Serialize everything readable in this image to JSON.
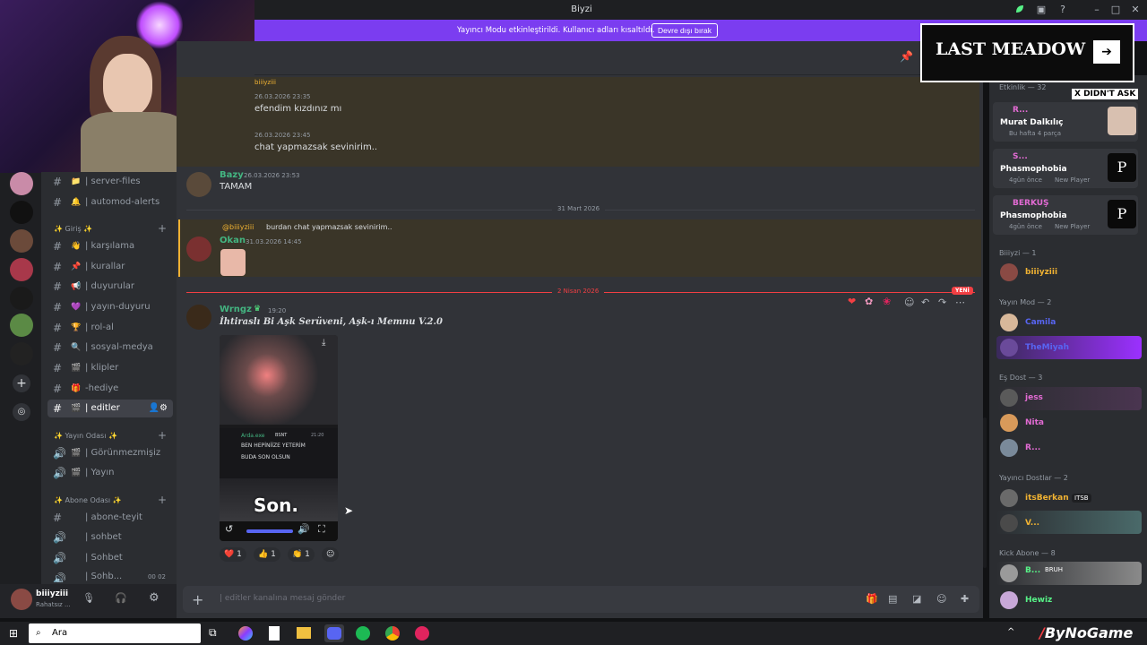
{
  "window": {
    "title": "Biyzi"
  },
  "banner": {
    "text": "Yayıncı Modu etkinleştirildi. Kullanıcı adları kısaltıldı.",
    "button": "Devre dışı bırak"
  },
  "overlay": {
    "ad_title": "LAST MEADOW",
    "ad_tag": "X DIDN'T ASK",
    "watermark": "ByNoGame"
  },
  "channels": {
    "top": [
      {
        "emoji": "📁",
        "name": "| server-files"
      },
      {
        "emoji": "🔔",
        "name": "| automod-alerts"
      }
    ],
    "cat1": {
      "name": "✨ Giriş ✨"
    },
    "cat1_items": [
      {
        "emoji": "👋",
        "name": "| karşılama"
      },
      {
        "emoji": "📌",
        "name": "| kurallar"
      },
      {
        "emoji": "📢",
        "name": "| duyurular"
      },
      {
        "emoji": "💜",
        "name": "| yayın-duyuru"
      },
      {
        "emoji": "🏆",
        "name": "| rol-al"
      },
      {
        "emoji": "🔍",
        "name": "| sosyal-medya"
      },
      {
        "emoji": "🎬",
        "name": "| klipler"
      },
      {
        "emoji": "🎁",
        "name": "-hediye"
      },
      {
        "emoji": "🎬",
        "name": "| editler"
      }
    ],
    "cat2": {
      "name": "✨ Yayın Odası ✨"
    },
    "cat2_items": [
      {
        "emoji": "🎬",
        "name": "| Görünmezmişiz"
      },
      {
        "emoji": "🎬",
        "name": "| Yayın"
      }
    ],
    "cat3": {
      "name": "✨ Abone Odası ✨"
    },
    "cat3_items": [
      {
        "emoji": "",
        "name": "| abone-teyit"
      },
      {
        "emoji": "",
        "name": "| sohbet"
      },
      {
        "emoji": "",
        "name": "| Sohbet"
      },
      {
        "emoji": "",
        "name": "| Sohb..."
      }
    ],
    "voice_counts": "00  02"
  },
  "user": {
    "name": "biiiyziii",
    "status": "Rahatsız ..."
  },
  "messages": [
    {
      "name": "biiiyziii",
      "time": "",
      "text": ""
    },
    {
      "name": "",
      "time": "26.03.2026 23:35",
      "text": "efendim kızdınız mı"
    },
    {
      "name": "",
      "time": "26.03.2026 23:45",
      "text": "chat yapmazsak sevinirim.."
    },
    {
      "name": "Bazy",
      "time": "26.03.2026 23:53",
      "text": "TAMAM"
    }
  ],
  "divider1": "31 Mart 2026",
  "reply": {
    "author": "@biiiyziii",
    "text": "burdan chat yapmazsak sevinirim.."
  },
  "okan": {
    "name": "Okan",
    "time": "31.03.2026 14:45"
  },
  "divider2": "2 Nisan 2026",
  "new_badge": "YENİ",
  "wrngz": {
    "name": "Wrngz",
    "time": "19:20",
    "text": "İhtiraslı Bi Aşk Serüveni, Aşk-ı Memnu V.2.0"
  },
  "video": {
    "inner_user": "Arda.exe",
    "inner_badge": "BSNT",
    "inner_time": "21:20",
    "inner_line1": "BEN HEPİNİİZE YETERİM",
    "inner_line2": "BUDA SON OLSUN",
    "subtitle": "Son."
  },
  "reactions": [
    {
      "emoji": "❤️",
      "count": "1"
    },
    {
      "emoji": "👍",
      "count": "1"
    },
    {
      "emoji": "👏",
      "count": "1"
    }
  ],
  "input": {
    "placeholder": "| editler kanalına mesaj gönder"
  },
  "members": {
    "activity_header": "Etkinlik — 32",
    "activity": [
      {
        "name": "R...",
        "game": "Murat Dalkılıç",
        "sub": "Bu hafta 4 parça"
      },
      {
        "name": "S...",
        "game": "Phasmophobia",
        "sub": "4gün önce",
        "extra": "New Player"
      },
      {
        "name": "BERKUŞ",
        "game": "Phasmophobia",
        "sub": "4gün önce",
        "extra": "New Player"
      }
    ],
    "groups": [
      {
        "header": "Biiiyzi — 1",
        "items": [
          {
            "name": "biiiyziii",
            "color": "#f0b232"
          }
        ]
      },
      {
        "header": "Yayın Mod — 2",
        "items": [
          {
            "name": "Camila",
            "color": "#5865f2"
          },
          {
            "name": "TheMiyah",
            "color": "#5865f2"
          }
        ]
      },
      {
        "header": "Eş Dost — 3",
        "items": [
          {
            "name": "jess",
            "color": "#e36bd4"
          },
          {
            "name": "Nita",
            "color": "#e36bd4"
          },
          {
            "name": "R...",
            "color": "#e36bd4"
          }
        ]
      },
      {
        "header": "Yayıncı Dostlar — 2",
        "items": [
          {
            "name": "itsBerkan",
            "color": "#f0b232",
            "badge": "ITSB"
          },
          {
            "name": "V...",
            "color": "#f0b232"
          }
        ]
      },
      {
        "header": "Kick Abone — 8",
        "items": [
          {
            "name": "B...",
            "color": "#57f287",
            "badge": "BRUH"
          },
          {
            "name": "Hewiz",
            "color": "#57f287"
          }
        ]
      }
    ]
  },
  "taskbar": {
    "search": "Ara"
  }
}
